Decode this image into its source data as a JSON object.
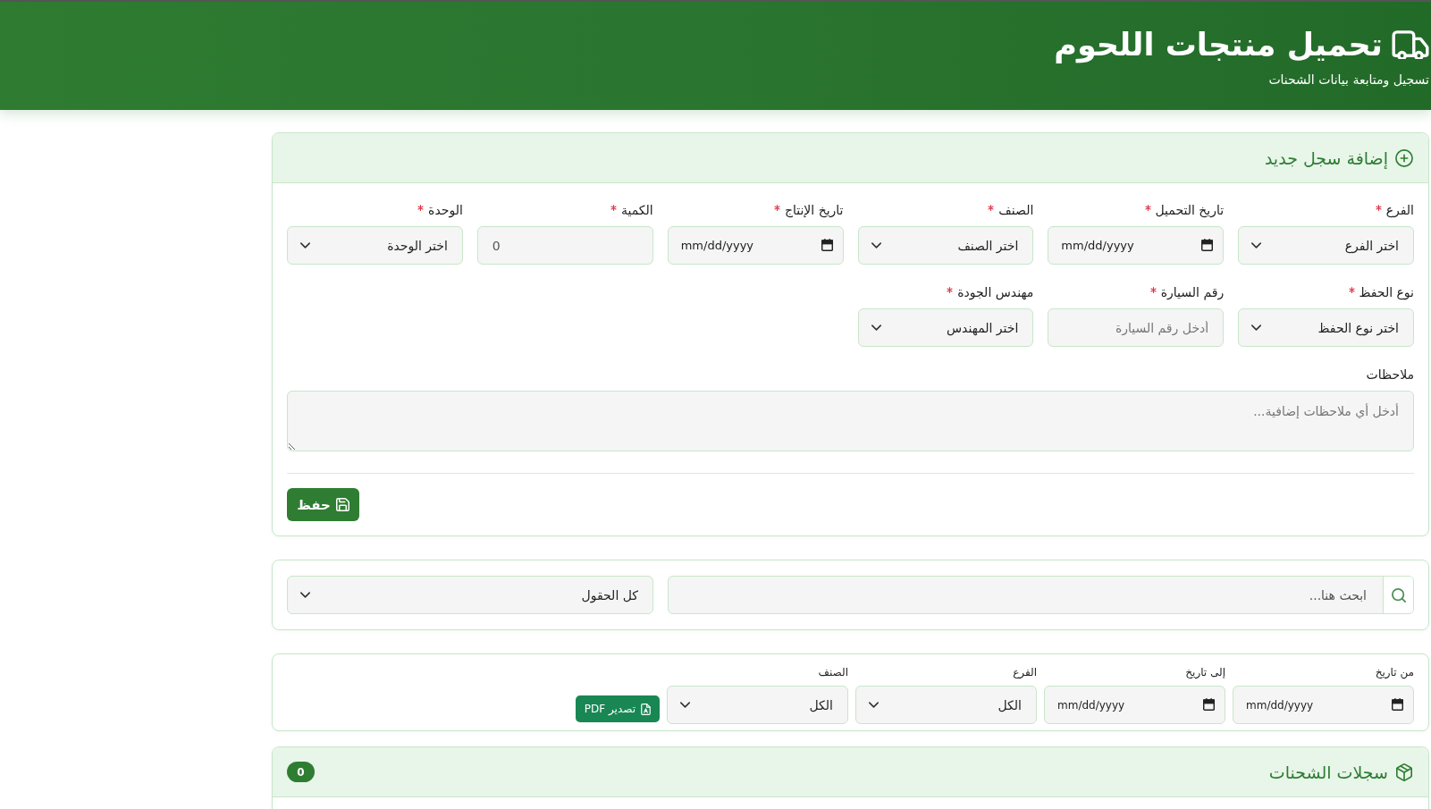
{
  "header": {
    "title": "تحميل منتجات اللحوم",
    "subtitle": "تسجيل ومتابعة بيانات الشحنات"
  },
  "entry_form": {
    "title": "إضافة سجل جديد",
    "fields": [
      {
        "kind": "select",
        "label": "الفرع",
        "required": true,
        "value": "اختر الفرع"
      },
      {
        "kind": "date",
        "label": "تاريخ التحميل",
        "required": true,
        "placeholder": "mm/dd/yyyy"
      },
      {
        "kind": "select",
        "label": "الصنف",
        "required": true,
        "value": "اختر الصنف"
      },
      {
        "kind": "date",
        "label": "تاريخ الإنتاج",
        "required": true,
        "placeholder": "mm/dd/yyyy"
      },
      {
        "kind": "number",
        "label": "الكمية",
        "required": true,
        "value": "0"
      },
      {
        "kind": "select",
        "label": "الوحدة",
        "required": true,
        "value": "اختر الوحدة"
      },
      {
        "kind": "select",
        "label": "نوع الحفظ",
        "required": true,
        "value": "اختر نوع الحفظ"
      },
      {
        "kind": "text",
        "label": "رقم السيارة",
        "required": true,
        "placeholder": "أدخل رقم السيارة"
      },
      {
        "kind": "select",
        "label": "مهندس الجودة",
        "required": true,
        "value": "اختر المهندس"
      }
    ],
    "notes": {
      "label": "ملاحظات",
      "placeholder": "أدخل أي ملاحظات إضافية..."
    },
    "save_button": "حفظ"
  },
  "search_bar": {
    "placeholder": "ابحث هنا...",
    "field_filter": "كل الحقول"
  },
  "filters": {
    "fields": [
      {
        "kind": "date",
        "label": "من تاريخ",
        "placeholder": "mm/dd/yyyy"
      },
      {
        "kind": "date",
        "label": "إلى تاريخ",
        "placeholder": "mm/dd/yyyy"
      },
      {
        "kind": "select",
        "label": "الفرع",
        "value": "الكل"
      },
      {
        "kind": "select",
        "label": "الصنف",
        "value": "الكل"
      }
    ],
    "export_button": "تصدير PDF"
  },
  "records": {
    "title": "سجلات الشحنات",
    "count": "0"
  }
}
